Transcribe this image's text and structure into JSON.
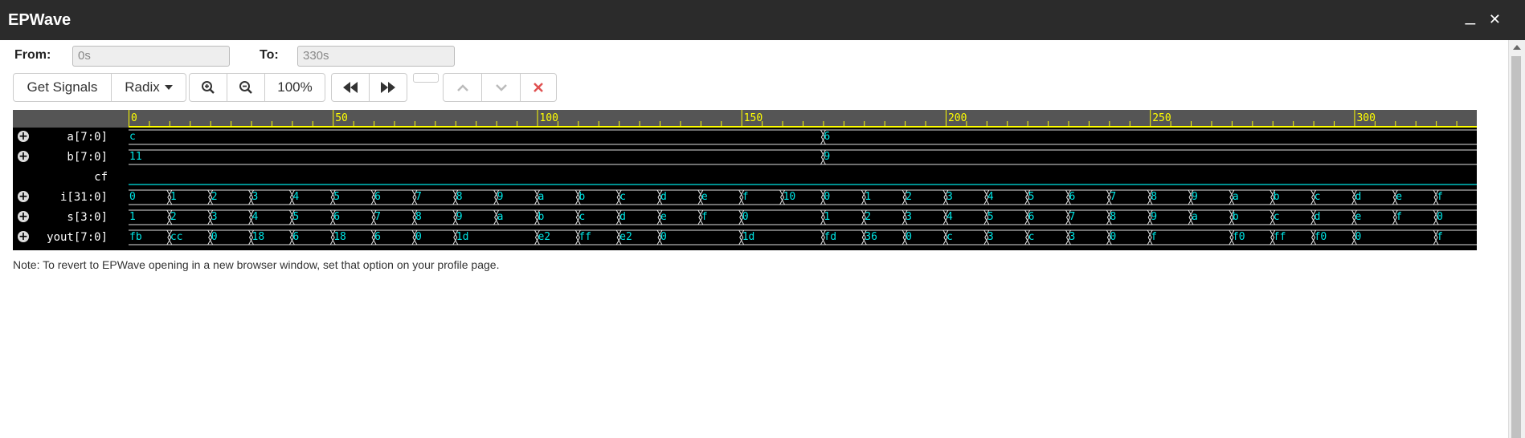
{
  "window": {
    "title": "EPWave",
    "minimize": "_",
    "close": "✕"
  },
  "range": {
    "from_label": "From:",
    "from_value": "0s",
    "to_label": "To:",
    "to_value": "330s"
  },
  "toolbar": {
    "get_signals": "Get Signals",
    "radix": "Radix",
    "zoom_in_icon": "zoom-in-icon",
    "zoom_out_icon": "zoom-out-icon",
    "zoom_level": "100%",
    "prev_icon": "fast-backward-icon",
    "next_icon": "fast-forward-icon",
    "up_icon": "chevron-up-icon",
    "down_icon": "chevron-down-icon",
    "delete_icon": "close-icon",
    "delete_color": "#e05050"
  },
  "waveform": {
    "time_start": 0,
    "time_end": 330,
    "ruler_labels": [
      "0",
      "50",
      "100",
      "150",
      "200",
      "250",
      "300"
    ],
    "colors": {
      "background": "#000000",
      "ruler": "#555555",
      "ruler_text": "#ffff00",
      "value_text": "#00e5e5",
      "line": "#e0e0e0",
      "scalar": "#00c0c0"
    },
    "signals": [
      {
        "name": "a[7:0]",
        "expandable": true,
        "kind": "bus",
        "transitions": [
          {
            "t": 0,
            "v": "c"
          },
          {
            "t": 170,
            "v": "6"
          }
        ]
      },
      {
        "name": "b[7:0]",
        "expandable": true,
        "kind": "bus",
        "transitions": [
          {
            "t": 0,
            "v": "11"
          },
          {
            "t": 170,
            "v": "9"
          }
        ]
      },
      {
        "name": "cf",
        "expandable": false,
        "kind": "scalar",
        "transitions": [
          {
            "t": 0,
            "v": "0"
          }
        ]
      },
      {
        "name": "i[31:0]",
        "expandable": true,
        "kind": "bus",
        "transitions": [
          {
            "t": 0,
            "v": "0"
          },
          {
            "t": 10,
            "v": "1"
          },
          {
            "t": 20,
            "v": "2"
          },
          {
            "t": 30,
            "v": "3"
          },
          {
            "t": 40,
            "v": "4"
          },
          {
            "t": 50,
            "v": "5"
          },
          {
            "t": 60,
            "v": "6"
          },
          {
            "t": 70,
            "v": "7"
          },
          {
            "t": 80,
            "v": "8"
          },
          {
            "t": 90,
            "v": "9"
          },
          {
            "t": 100,
            "v": "a"
          },
          {
            "t": 110,
            "v": "b"
          },
          {
            "t": 120,
            "v": "c"
          },
          {
            "t": 130,
            "v": "d"
          },
          {
            "t": 140,
            "v": "e"
          },
          {
            "t": 150,
            "v": "f"
          },
          {
            "t": 160,
            "v": "10"
          },
          {
            "t": 170,
            "v": "0"
          },
          {
            "t": 180,
            "v": "1"
          },
          {
            "t": 190,
            "v": "2"
          },
          {
            "t": 200,
            "v": "3"
          },
          {
            "t": 210,
            "v": "4"
          },
          {
            "t": 220,
            "v": "5"
          },
          {
            "t": 230,
            "v": "6"
          },
          {
            "t": 240,
            "v": "7"
          },
          {
            "t": 250,
            "v": "8"
          },
          {
            "t": 260,
            "v": "9"
          },
          {
            "t": 270,
            "v": "a"
          },
          {
            "t": 280,
            "v": "b"
          },
          {
            "t": 290,
            "v": "c"
          },
          {
            "t": 300,
            "v": "d"
          },
          {
            "t": 310,
            "v": "e"
          },
          {
            "t": 320,
            "v": "f"
          }
        ]
      },
      {
        "name": "s[3:0]",
        "expandable": true,
        "kind": "bus",
        "transitions": [
          {
            "t": 0,
            "v": "1"
          },
          {
            "t": 10,
            "v": "2"
          },
          {
            "t": 20,
            "v": "3"
          },
          {
            "t": 30,
            "v": "4"
          },
          {
            "t": 40,
            "v": "5"
          },
          {
            "t": 50,
            "v": "6"
          },
          {
            "t": 60,
            "v": "7"
          },
          {
            "t": 70,
            "v": "8"
          },
          {
            "t": 80,
            "v": "9"
          },
          {
            "t": 90,
            "v": "a"
          },
          {
            "t": 100,
            "v": "b"
          },
          {
            "t": 110,
            "v": "c"
          },
          {
            "t": 120,
            "v": "d"
          },
          {
            "t": 130,
            "v": "e"
          },
          {
            "t": 140,
            "v": "f"
          },
          {
            "t": 150,
            "v": "0"
          },
          {
            "t": 170,
            "v": "1"
          },
          {
            "t": 180,
            "v": "2"
          },
          {
            "t": 190,
            "v": "3"
          },
          {
            "t": 200,
            "v": "4"
          },
          {
            "t": 210,
            "v": "5"
          },
          {
            "t": 220,
            "v": "6"
          },
          {
            "t": 230,
            "v": "7"
          },
          {
            "t": 240,
            "v": "8"
          },
          {
            "t": 250,
            "v": "9"
          },
          {
            "t": 260,
            "v": "a"
          },
          {
            "t": 270,
            "v": "b"
          },
          {
            "t": 280,
            "v": "c"
          },
          {
            "t": 290,
            "v": "d"
          },
          {
            "t": 300,
            "v": "e"
          },
          {
            "t": 310,
            "v": "f"
          },
          {
            "t": 320,
            "v": "0"
          }
        ]
      },
      {
        "name": "yout[7:0]",
        "expandable": true,
        "kind": "bus",
        "transitions": [
          {
            "t": 0,
            "v": "fb"
          },
          {
            "t": 10,
            "v": "cc"
          },
          {
            "t": 20,
            "v": "0"
          },
          {
            "t": 30,
            "v": "18"
          },
          {
            "t": 40,
            "v": "6"
          },
          {
            "t": 50,
            "v": "18"
          },
          {
            "t": 60,
            "v": "6"
          },
          {
            "t": 70,
            "v": "0"
          },
          {
            "t": 80,
            "v": "1d"
          },
          {
            "t": 100,
            "v": "e2"
          },
          {
            "t": 110,
            "v": "ff"
          },
          {
            "t": 120,
            "v": "e2"
          },
          {
            "t": 130,
            "v": "0"
          },
          {
            "t": 150,
            "v": "1d"
          },
          {
            "t": 170,
            "v": "fd"
          },
          {
            "t": 180,
            "v": "36"
          },
          {
            "t": 190,
            "v": "0"
          },
          {
            "t": 200,
            "v": "c"
          },
          {
            "t": 210,
            "v": "3"
          },
          {
            "t": 220,
            "v": "c"
          },
          {
            "t": 230,
            "v": "3"
          },
          {
            "t": 240,
            "v": "0"
          },
          {
            "t": 250,
            "v": "f"
          },
          {
            "t": 270,
            "v": "f0"
          },
          {
            "t": 280,
            "v": "ff"
          },
          {
            "t": 290,
            "v": "f0"
          },
          {
            "t": 300,
            "v": "0"
          },
          {
            "t": 320,
            "v": "f"
          }
        ]
      }
    ]
  },
  "note": "Note: To revert to EPWave opening in a new browser window, set that option on your profile page."
}
